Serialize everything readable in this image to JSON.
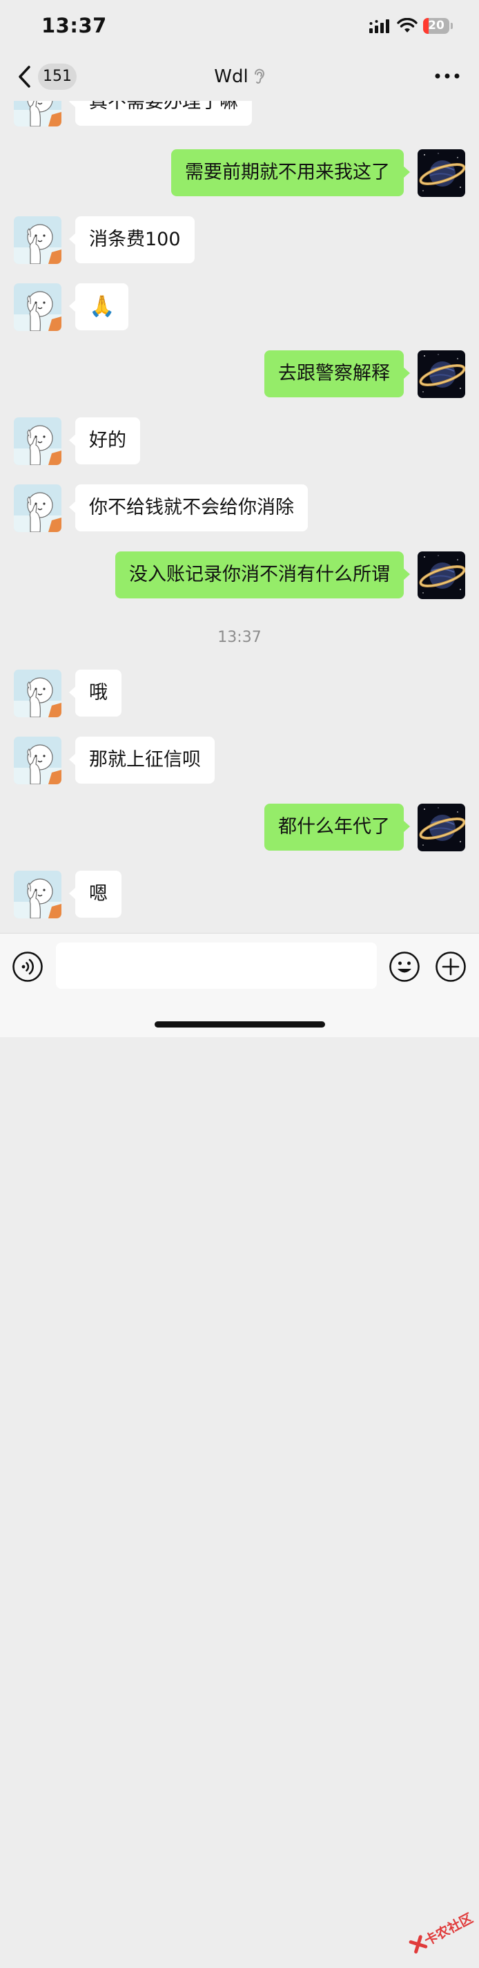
{
  "status_bar": {
    "time": "13:37",
    "battery_level": "20",
    "battery_fraction": 0.2
  },
  "nav": {
    "back_count": "151",
    "title": "Wdl"
  },
  "messages": [
    {
      "side": "in",
      "type": "text",
      "text": "真不需要办理了嘛"
    },
    {
      "side": "out",
      "type": "text",
      "text": "需要前期就不用来我这了"
    },
    {
      "side": "in",
      "type": "text",
      "text": "消条费100"
    },
    {
      "side": "in",
      "type": "emoji",
      "text": "🙏"
    },
    {
      "side": "out",
      "type": "text",
      "text": "去跟警察解释"
    },
    {
      "side": "in",
      "type": "text",
      "text": "好的"
    },
    {
      "side": "in",
      "type": "text",
      "text": "你不给钱就不会给你消除"
    },
    {
      "side": "out",
      "type": "text",
      "text": "没入账记录你消不消有什么所谓"
    },
    {
      "side": "in",
      "type": "text",
      "text": "哦"
    },
    {
      "side": "in",
      "type": "text",
      "text": "那就上征信呗"
    },
    {
      "side": "out",
      "type": "text",
      "text": "都什么年代了"
    },
    {
      "side": "in",
      "type": "text",
      "text": "嗯"
    }
  ],
  "timestamp": "13:37",
  "input": {
    "value": "",
    "placeholder": ""
  },
  "watermark": "卡农社区",
  "colors": {
    "background": "#ededed",
    "outgoing_bubble": "#95ec69",
    "incoming_bubble": "#ffffff",
    "battery_low": "#ff3b30"
  },
  "icons": {
    "back": "chevron-left-icon",
    "mute": "ear-icon",
    "more": "more-dots-icon",
    "voice": "voice-icon",
    "emoji": "emoji-face-icon",
    "plus": "plus-circle-icon"
  }
}
